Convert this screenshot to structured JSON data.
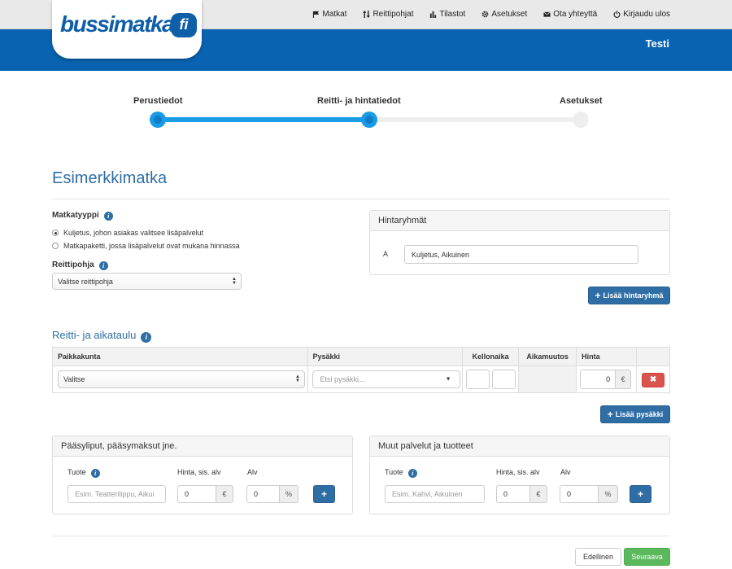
{
  "brand": {
    "logo_text": "bussimatkat",
    "logo_suffix": "fi"
  },
  "nav": {
    "items": [
      {
        "label": "Matkat",
        "icon": "flag-icon"
      },
      {
        "label": "Reittipohjat",
        "icon": "sort-icon"
      },
      {
        "label": "Tilastot",
        "icon": "bar-chart-icon"
      },
      {
        "label": "Asetukset",
        "icon": "gear-icon"
      },
      {
        "label": "Ota yhteyttä",
        "icon": "envelope-icon"
      },
      {
        "label": "Kirjaudu ulos",
        "icon": "power-icon"
      }
    ],
    "user": "Testi"
  },
  "stepper": {
    "steps": [
      {
        "label": "Perustiedot",
        "state": "done"
      },
      {
        "label": "Reitti- ja hintatiedot",
        "state": "current"
      },
      {
        "label": "Asetukset",
        "state": "todo"
      }
    ],
    "active_color": "#1a9be6",
    "inactive_color": "#eeeeee"
  },
  "page": {
    "title": "Esimerkkimatka"
  },
  "trip_type": {
    "label": "Matkatyyppi",
    "options": [
      {
        "label": "Kuljetus, johon asiakas valitsee lisäpalvelut",
        "checked": true
      },
      {
        "label": "Matkapaketti, jossa lisäpalvelut ovat mukana hinnassa",
        "checked": false
      }
    ]
  },
  "route_template": {
    "label": "Reittipohja",
    "selected": "Valitse reittipohja"
  },
  "price_groups": {
    "title": "Hintaryhmät",
    "rows": [
      {
        "key": "A",
        "value": "Kuljetus, Aikuinen"
      }
    ],
    "add_label": "Lisää hintaryhmä"
  },
  "route": {
    "title": "Reitti- ja aikataulu",
    "columns": [
      "Paikkakunta",
      "Pysäkki",
      "Kellonaika",
      "Aikamuutos",
      "Hinta"
    ],
    "row": {
      "municipality": "Valitse",
      "stop_placeholder": "Etsi pysäkki...",
      "price": "0",
      "currency": "€",
      "delete_symbol": "✖"
    },
    "add_stop_label": "Lisää pysäkki"
  },
  "tickets": {
    "title": "Pääsyliput, pääsymaksut jne.",
    "product_label": "Tuote",
    "price_label": "Hinta, sis. alv",
    "vat_label": "Alv",
    "product_placeholder": "Esim. Teatterilippu, Aikui",
    "price_value": "0",
    "price_unit": "€",
    "vat_value": "0",
    "vat_unit": "%"
  },
  "other_services": {
    "title": "Muut palvelut ja tuotteet",
    "product_label": "Tuote",
    "price_label": "Hinta, sis. alv",
    "vat_label": "Alv",
    "product_placeholder": "Esim. Kahvi, Aikuinen",
    "price_value": "0",
    "price_unit": "€",
    "vat_value": "0",
    "vat_unit": "%"
  },
  "footer": {
    "prev_label": "Edellinen",
    "next_label": "Seuraava"
  },
  "colors": {
    "brand_blue": "#0a63b0",
    "heading_blue": "#2f6ea5",
    "danger": "#d9534f",
    "success": "#5cb85c"
  }
}
